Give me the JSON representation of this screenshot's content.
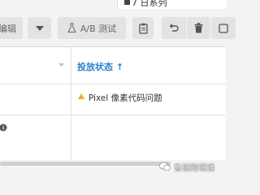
{
  "breadcrumb": {
    "text": "7 日系列"
  },
  "toolbar": {
    "edit_label": "编辑",
    "ab_test_label": "A/B 测试"
  },
  "table": {
    "header": {
      "status_label": "投放状态 ↑"
    },
    "row1": {
      "status_text": "Pixel 像素代码问题"
    }
  },
  "watermark": {
    "text": "鲁班跨境通"
  },
  "colors": {
    "accent": "#2f7fd1",
    "warning": "#f5a623"
  },
  "icons": [
    "caret-down-icon",
    "flask-icon",
    "clipboard-icon",
    "undo-icon",
    "trash-icon",
    "more-icon",
    "sort-arrow-icon",
    "warning-icon",
    "info-icon",
    "wechat-icon"
  ]
}
